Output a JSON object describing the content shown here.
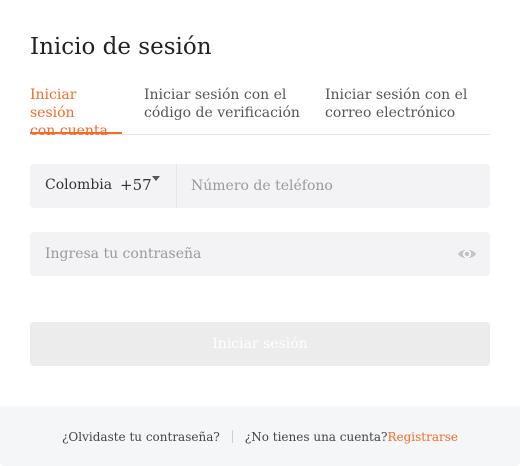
{
  "dialog": {
    "title": "Inicio de sesión"
  },
  "tabs": [
    {
      "line1": "Iniciar sesión",
      "line2": "con cuenta",
      "active": true
    },
    {
      "line1": "Iniciar sesión con el",
      "line2": "código de verificación",
      "active": false
    },
    {
      "line1": "Iniciar sesión con el",
      "line2": "correo electrónico",
      "active": false
    }
  ],
  "phone": {
    "country_name": "Colombia",
    "country_code": "+57",
    "value": "",
    "placeholder": "Número de teléfono"
  },
  "password": {
    "value": "",
    "placeholder": "Ingresa tu contraseña",
    "visibility_icon": "eye-icon"
  },
  "submit": {
    "label": "Iniciar sesión",
    "enabled": false
  },
  "footer": {
    "forgot_password": "¿Olvidaste tu contraseña?",
    "no_account": "¿No tienes una cuenta?",
    "register": "Registrarse"
  },
  "colors": {
    "accent": "#f26b2a",
    "field_background": "#f3f3f5",
    "disabled_button": "#ececec",
    "footer_background": "#f5f6f8"
  }
}
